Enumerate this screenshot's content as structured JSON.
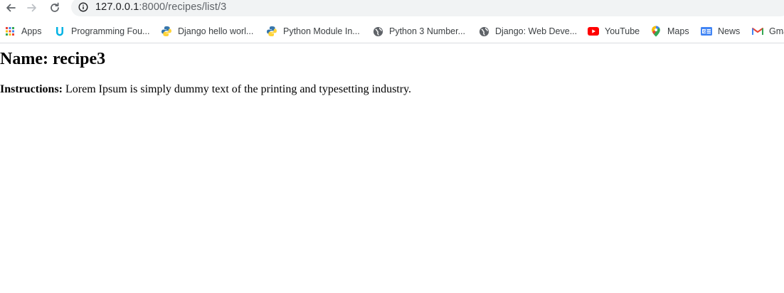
{
  "browser": {
    "url_host": "127.0.0.1",
    "url_path": ":8000/recipes/list/3"
  },
  "bookmarks": [
    {
      "label": "Apps",
      "icon": "apps-grid-icon"
    },
    {
      "label": "Programming Fou...",
      "icon": "udacity-icon"
    },
    {
      "label": "Django hello worl...",
      "icon": "python-icon"
    },
    {
      "label": "Python Module In...",
      "icon": "python-icon"
    },
    {
      "label": "Python 3 Number...",
      "icon": "globe-icon"
    },
    {
      "label": "Django: Web Deve...",
      "icon": "globe-icon"
    },
    {
      "label": "YouTube",
      "icon": "youtube-icon"
    },
    {
      "label": "Maps",
      "icon": "maps-icon"
    },
    {
      "label": "News",
      "icon": "news-icon"
    },
    {
      "label": "Gma",
      "icon": "gmail-icon"
    }
  ],
  "recipe": {
    "name_label": "Name: ",
    "name": "recipe3",
    "instructions_label": "Instructions:",
    "instructions": " Lorem Ipsum is simply dummy text of the printing and typesetting industry."
  }
}
